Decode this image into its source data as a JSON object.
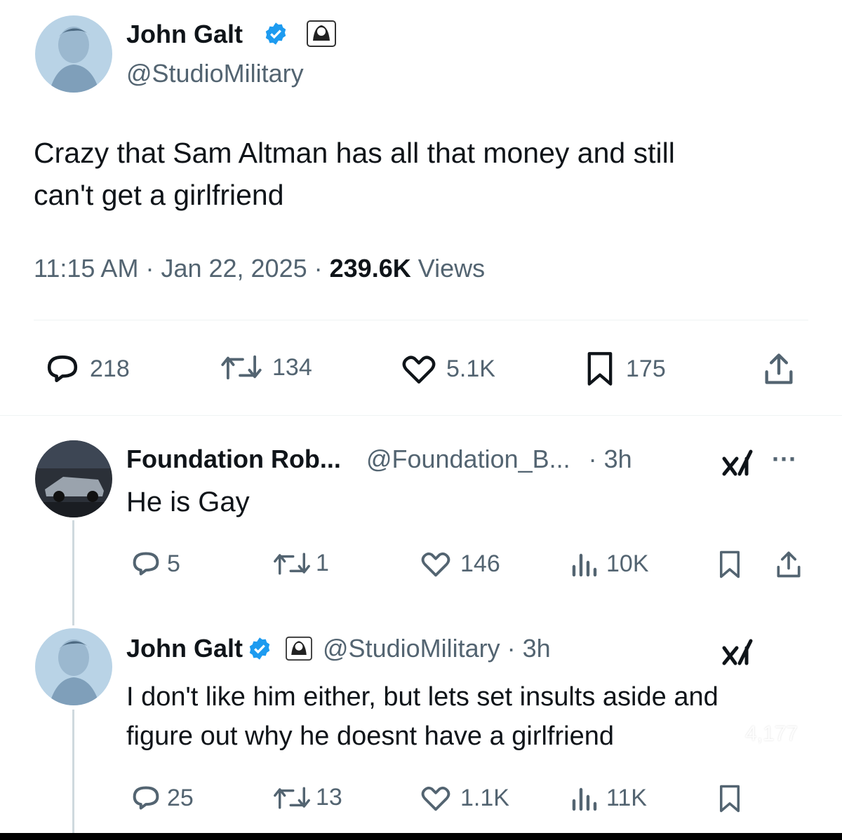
{
  "main_tweet": {
    "author_name": "John Galt",
    "handle": "@StudioMilitary",
    "text_line1": "Crazy that Sam Altman has all that money and still",
    "text_line2": "can't get a girlfriend",
    "time": "11:15 AM",
    "date": "Jan 22, 2025",
    "separator": "·",
    "views_count": "239.6K",
    "views_label": "Views",
    "replies": "218",
    "reposts": "134",
    "likes": "5.1K",
    "bookmarks": "175",
    "icons": {
      "verified": "verified-badge-icon",
      "affiliate": "affiliate-badge-icon",
      "reply": "reply-icon",
      "repost": "repost-icon",
      "like": "heart-icon",
      "bookmark": "bookmark-icon",
      "share": "share-icon"
    }
  },
  "reply1": {
    "author_name": "Foundation Rob...",
    "handle": "@Foundation_B...",
    "time": "· 3h",
    "text": "He is Gay",
    "replies": "5",
    "reposts": "1",
    "likes": "146",
    "views": "10K",
    "more": "···"
  },
  "reply2": {
    "author_name": "John Galt",
    "handle": "@StudioMilitary",
    "time": "· 3h",
    "text_line1": "I don't like him either, but lets set insults aside and",
    "text_line2": "figure out why he doesnt have a girlfriend",
    "replies": "25",
    "reposts": "13",
    "likes": "1.1K",
    "views": "11K"
  },
  "overlay": {
    "like_count": "4,177"
  },
  "colors": {
    "verified_blue": "#1d9bf0",
    "text_primary": "#0f1419",
    "text_secondary": "#536471",
    "divider": "#eff3f4"
  }
}
